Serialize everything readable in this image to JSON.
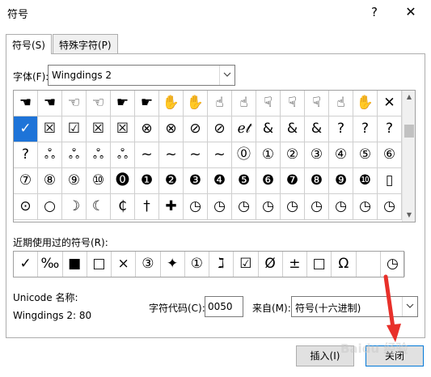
{
  "window": {
    "title": "符号",
    "help_label": "?",
    "close_label": "✕"
  },
  "tabs": [
    {
      "label": "符号(S)",
      "active": true
    },
    {
      "label": "特殊字符(P)",
      "active": false
    }
  ],
  "font": {
    "label": "字体(F):",
    "value": "Wingdings 2"
  },
  "symbol_grid": {
    "rows": [
      [
        "☚",
        "☚",
        "☜",
        "☜",
        "☛",
        "☛",
        "✋",
        "✋",
        "☝",
        "☝",
        "☟",
        "☟",
        "☟",
        "☝",
        "✋",
        "✕"
      ],
      [
        "✓",
        "☒",
        "☑",
        "☒",
        "☒",
        "⊗",
        "⊗",
        "⊘",
        "⊘",
        "ℯ𝓉",
        "&",
        "&",
        "&",
        "?",
        "?",
        "?"
      ],
      [
        "?",
        "ஃ",
        "ஃ",
        "ஃ",
        "ஃ",
        "~",
        "~",
        "~",
        "~",
        "⓪",
        "①",
        "②",
        "③",
        "④",
        "⑤",
        "⑥"
      ],
      [
        "⑦",
        "⑧",
        "⑨",
        "⑩",
        "⓿",
        "❶",
        "❷",
        "❸",
        "❹",
        "❺",
        "❻",
        "❼",
        "❽",
        "❾",
        "❿",
        "▯"
      ],
      [
        "⊙",
        "○",
        "☽",
        "☾",
        "₵",
        "†",
        "✚",
        "◷",
        "◷",
        "◷",
        "◷",
        "◷",
        "◷",
        "◷",
        "◷",
        "◷"
      ]
    ],
    "selected": [
      1,
      0
    ]
  },
  "recent": {
    "label": "近期使用过的符号(R):",
    "symbols": [
      "✓",
      "‰",
      "■",
      "□",
      "×",
      "③",
      "✦",
      "①",
      "ℷ",
      "☑",
      "Ø",
      "±",
      "□",
      "Ω",
      "",
      "◷"
    ]
  },
  "unicode": {
    "label": "Unicode 名称:",
    "value": "Wingdings 2: 80"
  },
  "char_code": {
    "label": "字符代码(C):",
    "value": "0050"
  },
  "from": {
    "label": "来自(M):",
    "value": "符号(十六进制)"
  },
  "buttons": {
    "insert": "插入(I)",
    "close": "关闭"
  },
  "watermark": "Baidu 经验",
  "colors": {
    "selected_cell": "#1e74d8",
    "annotation_arrow": "#e8302a"
  }
}
